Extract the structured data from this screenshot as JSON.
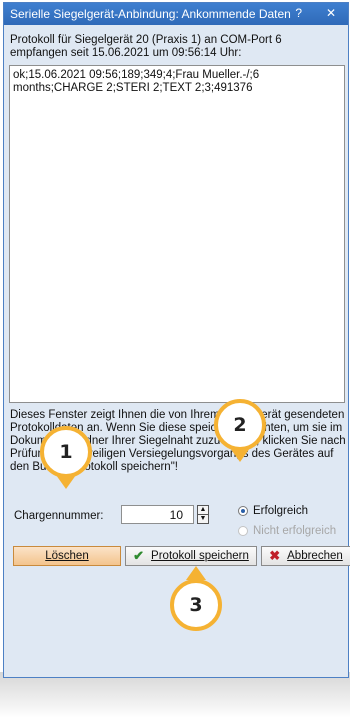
{
  "window": {
    "title": "Serielle Siegelgerät-Anbindung: Ankommende Daten",
    "help_label": "?",
    "close_label": "✕"
  },
  "header": {
    "line1": "Protokoll für Siegelgerät 20 (Praxis 1) an COM-Port 6",
    "line2": "empfangen seit 15.06.2021 um 09:56:14 Uhr:"
  },
  "protocol": {
    "content": "ok;15.06.2021 09:56;189;349;4;Frau Mueller.-/;6 months;CHARGE 2;STERI  2;TEXT  2;3;491376"
  },
  "info": {
    "lines": [
      "Dieses Fenster zeigt Ihnen die von Ihrem Siegelgerät gesendeten",
      "Protokolldaten an. Wenn Sie diese speichern möchten, um sie im",
      "Dokumentenordner Ihrer Siegelnaht zuzuordnen, klicken Sie nach",
      "Prüfung des jeweiligen Versiegelungsvorgangs des Gerätes auf",
      "den Button \"Protokoll speichern\"!"
    ]
  },
  "charge": {
    "label": "Chargennummer:",
    "value": "10"
  },
  "result": {
    "success_label": "Erfolgreich",
    "fail_label": "Nicht erfolgreich",
    "selected": "success"
  },
  "buttons": {
    "delete_label": "Löschen",
    "save_label": "Protokoll speichern",
    "cancel_label": "Abbrechen"
  },
  "callouts": [
    "1",
    "2",
    "3"
  ],
  "colors": {
    "titlebar": "#3a78c8",
    "dialog_bg": "#dfe8f3",
    "callout_ring": "#f5b233",
    "delete_button": "#f3c48d"
  }
}
